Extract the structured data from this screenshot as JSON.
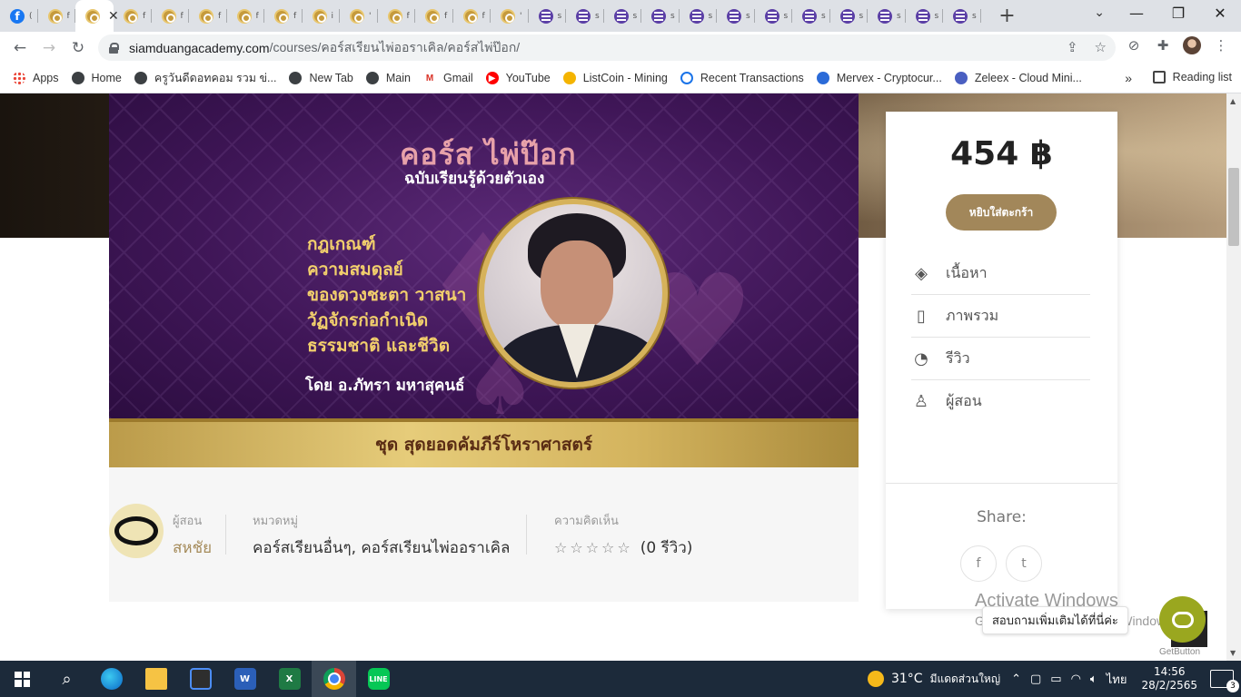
{
  "browser": {
    "tabs": [
      {
        "kind": "facebook",
        "title": "(",
        "active": false
      },
      {
        "kind": "sd",
        "title": "f",
        "active": false
      },
      {
        "kind": "sd",
        "title": "ค",
        "active": true
      },
      {
        "kind": "sd",
        "title": "f",
        "active": false
      },
      {
        "kind": "sd",
        "title": "f",
        "active": false
      },
      {
        "kind": "sd",
        "title": "f",
        "active": false
      },
      {
        "kind": "sd",
        "title": "f",
        "active": false
      },
      {
        "kind": "sd",
        "title": "f",
        "active": false
      },
      {
        "kind": "sd",
        "title": "i",
        "active": false
      },
      {
        "kind": "sd",
        "title": "'",
        "active": false
      },
      {
        "kind": "sd",
        "title": "f",
        "active": false
      },
      {
        "kind": "sd",
        "title": "f",
        "active": false
      },
      {
        "kind": "sd",
        "title": "f",
        "active": false
      },
      {
        "kind": "sd",
        "title": "'",
        "active": false
      },
      {
        "kind": "ms",
        "title": "s",
        "active": false
      },
      {
        "kind": "ms",
        "title": "s",
        "active": false
      },
      {
        "kind": "ms",
        "title": "s",
        "active": false
      },
      {
        "kind": "ms",
        "title": "s",
        "active": false
      },
      {
        "kind": "ms",
        "title": "s",
        "active": false
      },
      {
        "kind": "ms",
        "title": "s",
        "active": false
      },
      {
        "kind": "ms",
        "title": "s",
        "active": false
      },
      {
        "kind": "ms",
        "title": "s",
        "active": false
      },
      {
        "kind": "ms",
        "title": "s",
        "active": false
      },
      {
        "kind": "ms",
        "title": "s",
        "active": false
      },
      {
        "kind": "ms",
        "title": "s",
        "active": false
      },
      {
        "kind": "ms",
        "title": "s",
        "active": false
      }
    ],
    "url_host": "siamduangacademy.com",
    "url_path": "/courses/คอร์สเรียนไพ่ออราเคิล/คอร์สไพ่ป๊อก/",
    "bookmarks": [
      {
        "label": "Apps",
        "icon": "apps-icon"
      },
      {
        "label": "Home",
        "icon": "globe-icon"
      },
      {
        "label": "ครูวันดีดอทคอม รวม ข่...",
        "icon": "globe-icon"
      },
      {
        "label": "New Tab",
        "icon": "globe-icon"
      },
      {
        "label": "Main",
        "icon": "globe-icon"
      },
      {
        "label": "Gmail",
        "icon": "gmail-icon"
      },
      {
        "label": "YouTube",
        "icon": "youtube-icon"
      },
      {
        "label": "ListCoin - Mining",
        "icon": "listcoin-icon"
      },
      {
        "label": "Recent Transactions",
        "icon": "recent-transactions-icon"
      },
      {
        "label": "Mervex - Cryptocur...",
        "icon": "mervex-icon"
      },
      {
        "label": "Zeleex - Cloud Mini...",
        "icon": "zeleex-icon"
      }
    ],
    "more_bookmarks": "»",
    "reading_list": "Reading list"
  },
  "banner": {
    "title": "คอร์ส ไพ่ป๊อก",
    "subtitle": "ฉบับเรียนรู้ด้วยตัวเอง",
    "lines": [
      "กฎเกณฑ์",
      "ความสมดุลย์",
      "ของดวงชะตา วาสนา",
      "วัฏจักรก่อกำเนิด",
      "ธรรมชาติ และชีวิต"
    ],
    "author": "โดย อ.ภัทรา มหาสุคนธ์",
    "series": "ชุด สุดยอดคัมภีร์โหราศาสตร์"
  },
  "meta": {
    "instructor_label": "ผู้สอน",
    "instructor_value": "สหชัย",
    "category_label": "หมวดหมู่",
    "category_value": "คอร์สเรียนอื่นๆ, คอร์สเรียนไพ่ออราเคิล",
    "review_label": "ความคิดเห็น",
    "rating": 0,
    "review_count": "(0 รีวิว)"
  },
  "sidebar": {
    "price": "454 ฿",
    "cart_button": "หยิบใส่ตะกร้า",
    "menu": [
      {
        "label": "เนื้อหา",
        "icon": "tag-icon"
      },
      {
        "label": "ภาพรวม",
        "icon": "document-icon"
      },
      {
        "label": "รีวิว",
        "icon": "comments-icon"
      },
      {
        "label": "ผู้สอน",
        "icon": "user-icon"
      }
    ],
    "share_label": "Share:"
  },
  "overlay": {
    "activate_title": "Activate Windows",
    "activate_sub": "Go to Settings to activate Windows.",
    "chat_tooltip": "สอบถามเพิ่มเติมได้ที่นี่ค่ะ",
    "getbutton": "GetButton"
  },
  "taskbar": {
    "temperature": "31°C",
    "weather_text": "มีแดดส่วนใหญ่",
    "language": "ไทย",
    "time": "14:56",
    "date": "28/2/2565",
    "notification_count": "3"
  }
}
